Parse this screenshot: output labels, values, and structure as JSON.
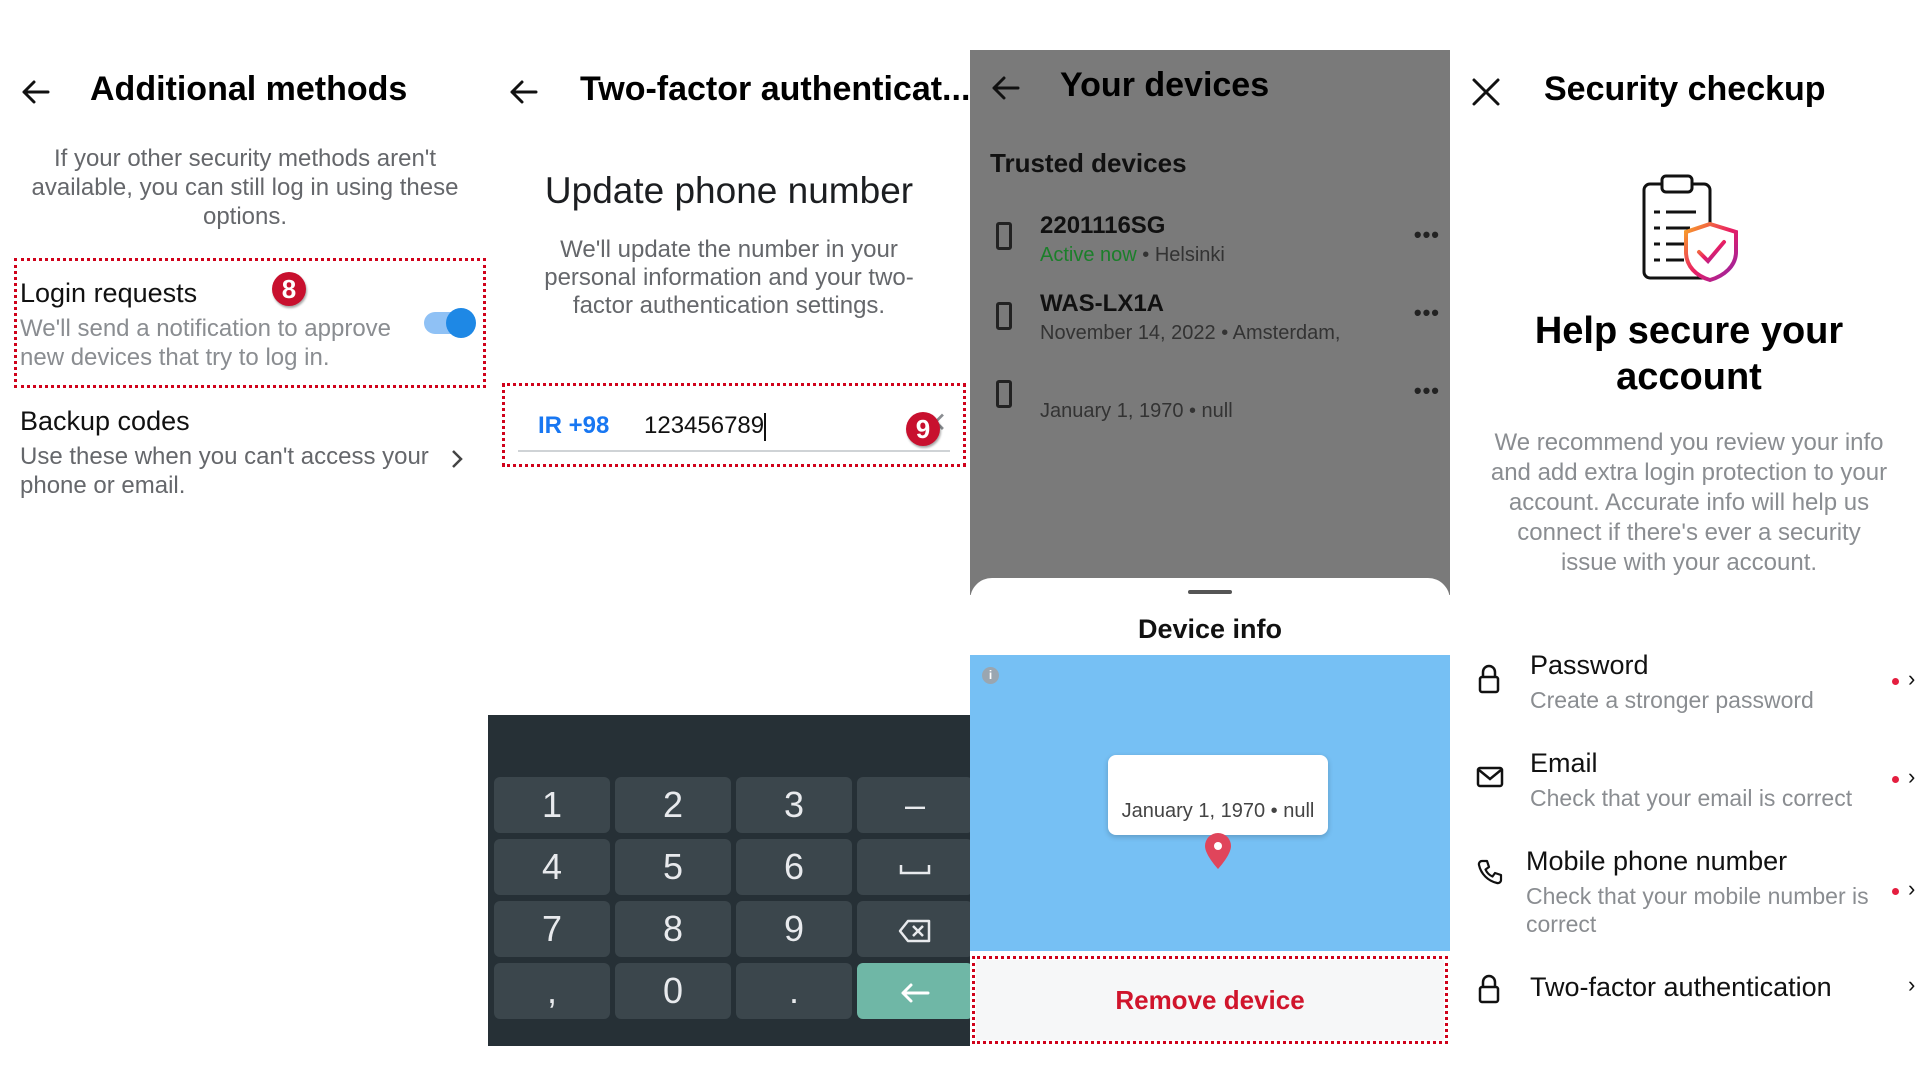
{
  "panel1": {
    "title": "Additional methods",
    "intro": "If your other security methods aren't available, you can still log in using these options.",
    "login_requests": {
      "title": "Login requests",
      "desc": "We'll send a notification to approve new devices that try to log in.",
      "toggle_on": true,
      "badge": "8"
    },
    "backup_codes": {
      "title": "Backup codes",
      "desc": "Use these when you can't access your phone or email."
    }
  },
  "panel2": {
    "title": "Two-factor authenticat...",
    "heading": "Update phone number",
    "desc": "We'll update the number in your personal information and your two-factor authentication settings.",
    "country_code": "IR +98",
    "phone_value": "123456789",
    "badge": "9",
    "keys": [
      [
        "1",
        "2",
        "3",
        "–"
      ],
      [
        "4",
        "5",
        "6",
        "space"
      ],
      [
        "7",
        "8",
        "9",
        "backspace"
      ],
      [
        ",",
        "0",
        ".",
        "enter"
      ]
    ]
  },
  "panel3": {
    "title": "Your devices",
    "section": "Trusted devices",
    "devices": [
      {
        "name": "2201116SG",
        "status": "Active now",
        "location": " • Helsinki"
      },
      {
        "name": "WAS-LX1A",
        "status": "",
        "location": "November 14, 2022 • Amsterdam,"
      },
      {
        "name": "",
        "status": "",
        "location": "January 1, 1970 • null"
      }
    ],
    "sheet_title": "Device info",
    "map_label": "January 1, 1970 • null",
    "remove_label": "Remove device"
  },
  "panel4": {
    "title": "Security checkup",
    "heading": "Help secure your account",
    "desc": "We recommend you review your info and add extra login protection to your account. Accurate info will help us connect if there's ever a security issue with your account.",
    "rows": [
      {
        "title": "Password",
        "sub": "Create a stronger password",
        "icon": "lock-icon",
        "alert": true
      },
      {
        "title": "Email",
        "sub": "Check that your email is correct",
        "icon": "mail-icon",
        "alert": true
      },
      {
        "title": "Mobile phone number",
        "sub": "Check that your mobile number is correct",
        "icon": "phone-call-icon",
        "alert": true
      },
      {
        "title": "Two-factor authentication",
        "sub": "",
        "icon": "lock-icon",
        "alert": false
      }
    ]
  },
  "colors": {
    "accent_blue": "#1e88e5",
    "alert_red": "#e41e3f",
    "highlight_red": "#d0021b",
    "active_green": "#1b7f2a",
    "keypad_bg": "#263036",
    "map_bg": "#76c0f4"
  }
}
